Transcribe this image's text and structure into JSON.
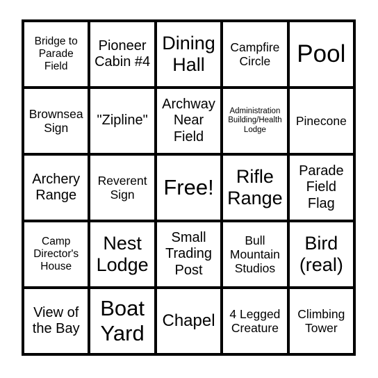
{
  "card": {
    "type": "bingo-card",
    "grid_size": "5x5",
    "free_space": {
      "row": 3,
      "column": 3,
      "label": "Free!"
    },
    "border_color": "#000000",
    "background_color": "#ffffff",
    "text_color": "#000000",
    "rows": [
      {
        "cells": [
          {
            "label": "Bridge to Parade Field",
            "size": "sm"
          },
          {
            "label": "Pioneer Cabin #4",
            "size": "lg"
          },
          {
            "label": "Dining Hall",
            "size": "2xl"
          },
          {
            "label": "Campfire Circle",
            "size": "md"
          },
          {
            "label": "Pool",
            "size": "4xl"
          }
        ]
      },
      {
        "cells": [
          {
            "label": "Brownsea Sign",
            "size": "md"
          },
          {
            "label": "\"Zipline\"",
            "size": "lg"
          },
          {
            "label": "Archway Near Field",
            "size": "lg"
          },
          {
            "label": "Administration Building/Health Lodge",
            "size": "xs"
          },
          {
            "label": "Pinecone",
            "size": "md"
          }
        ]
      },
      {
        "cells": [
          {
            "label": "Archery Range",
            "size": "lg"
          },
          {
            "label": "Reverent Sign",
            "size": "md"
          },
          {
            "label": "Free!",
            "size": "3xl"
          },
          {
            "label": "Rifle Range",
            "size": "2xl"
          },
          {
            "label": "Parade Field Flag",
            "size": "lg"
          }
        ]
      },
      {
        "cells": [
          {
            "label": "Camp Director's House",
            "size": "sm"
          },
          {
            "label": "Nest Lodge",
            "size": "2xl"
          },
          {
            "label": "Small Trading Post",
            "size": "lg"
          },
          {
            "label": "Bull Mountain Studios",
            "size": "md"
          },
          {
            "label": "Bird (real)",
            "size": "2xl"
          }
        ]
      },
      {
        "cells": [
          {
            "label": "View of the Bay",
            "size": "lg"
          },
          {
            "label": "Boat Yard",
            "size": "3xl"
          },
          {
            "label": "Chapel",
            "size": "xl"
          },
          {
            "label": "4 Legged Creature",
            "size": "md"
          },
          {
            "label": "Climbing Tower",
            "size": "md"
          }
        ]
      }
    ]
  }
}
